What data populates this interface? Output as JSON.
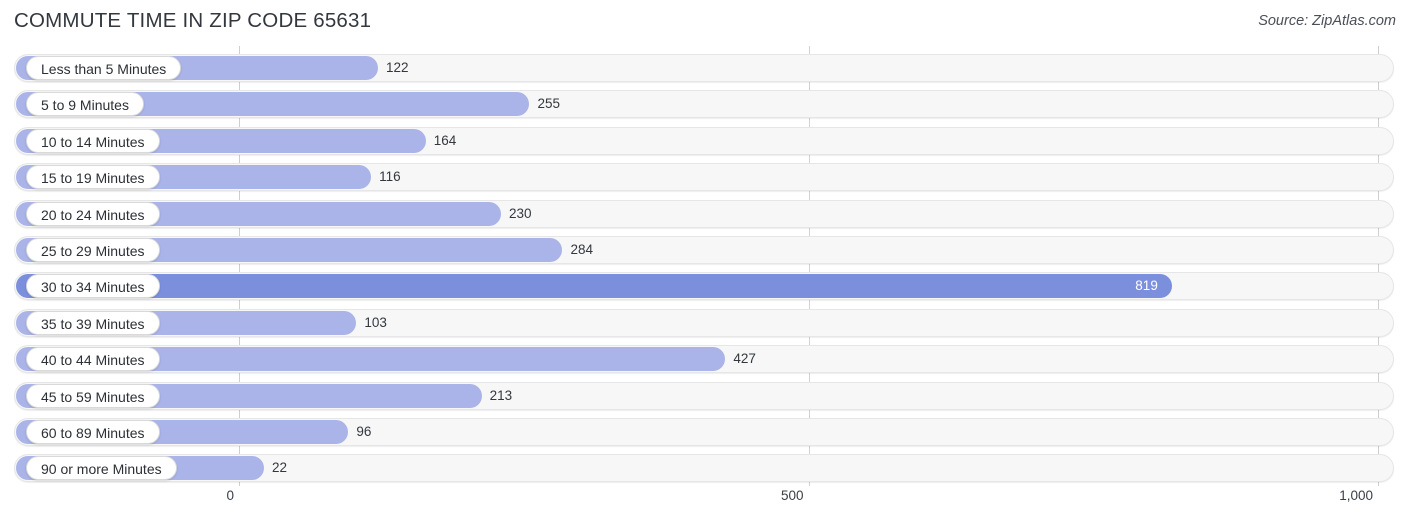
{
  "header": {
    "title": "COMMUTE TIME IN ZIP CODE 65631",
    "source": "Source: ZipAtlas.com"
  },
  "colors": {
    "bar": "#aab4e8",
    "bar_highlight": "#7b8fdd",
    "track": "#f7f7f7",
    "gridline": "#d3d3d3",
    "title_text": "#33383f"
  },
  "chart_data": {
    "type": "bar",
    "orientation": "horizontal",
    "title": "COMMUTE TIME IN ZIP CODE 65631",
    "xlabel": "",
    "ylabel": "",
    "xlim": [
      0,
      1000
    ],
    "grid": true,
    "legend": null,
    "ticks": [
      "0",
      "500",
      "1,000"
    ],
    "tick_values": [
      0,
      500,
      1000
    ],
    "categories": [
      "Less than 5 Minutes",
      "5 to 9 Minutes",
      "10 to 14 Minutes",
      "15 to 19 Minutes",
      "20 to 24 Minutes",
      "25 to 29 Minutes",
      "30 to 34 Minutes",
      "35 to 39 Minutes",
      "40 to 44 Minutes",
      "45 to 59 Minutes",
      "60 to 89 Minutes",
      "90 or more Minutes"
    ],
    "values": [
      122,
      255,
      164,
      116,
      230,
      284,
      819,
      103,
      427,
      213,
      96,
      22
    ],
    "value_labels": [
      "122",
      "255",
      "164",
      "116",
      "230",
      "284",
      "819",
      "103",
      "427",
      "213",
      "96",
      "22"
    ],
    "highlight_index": 6
  }
}
